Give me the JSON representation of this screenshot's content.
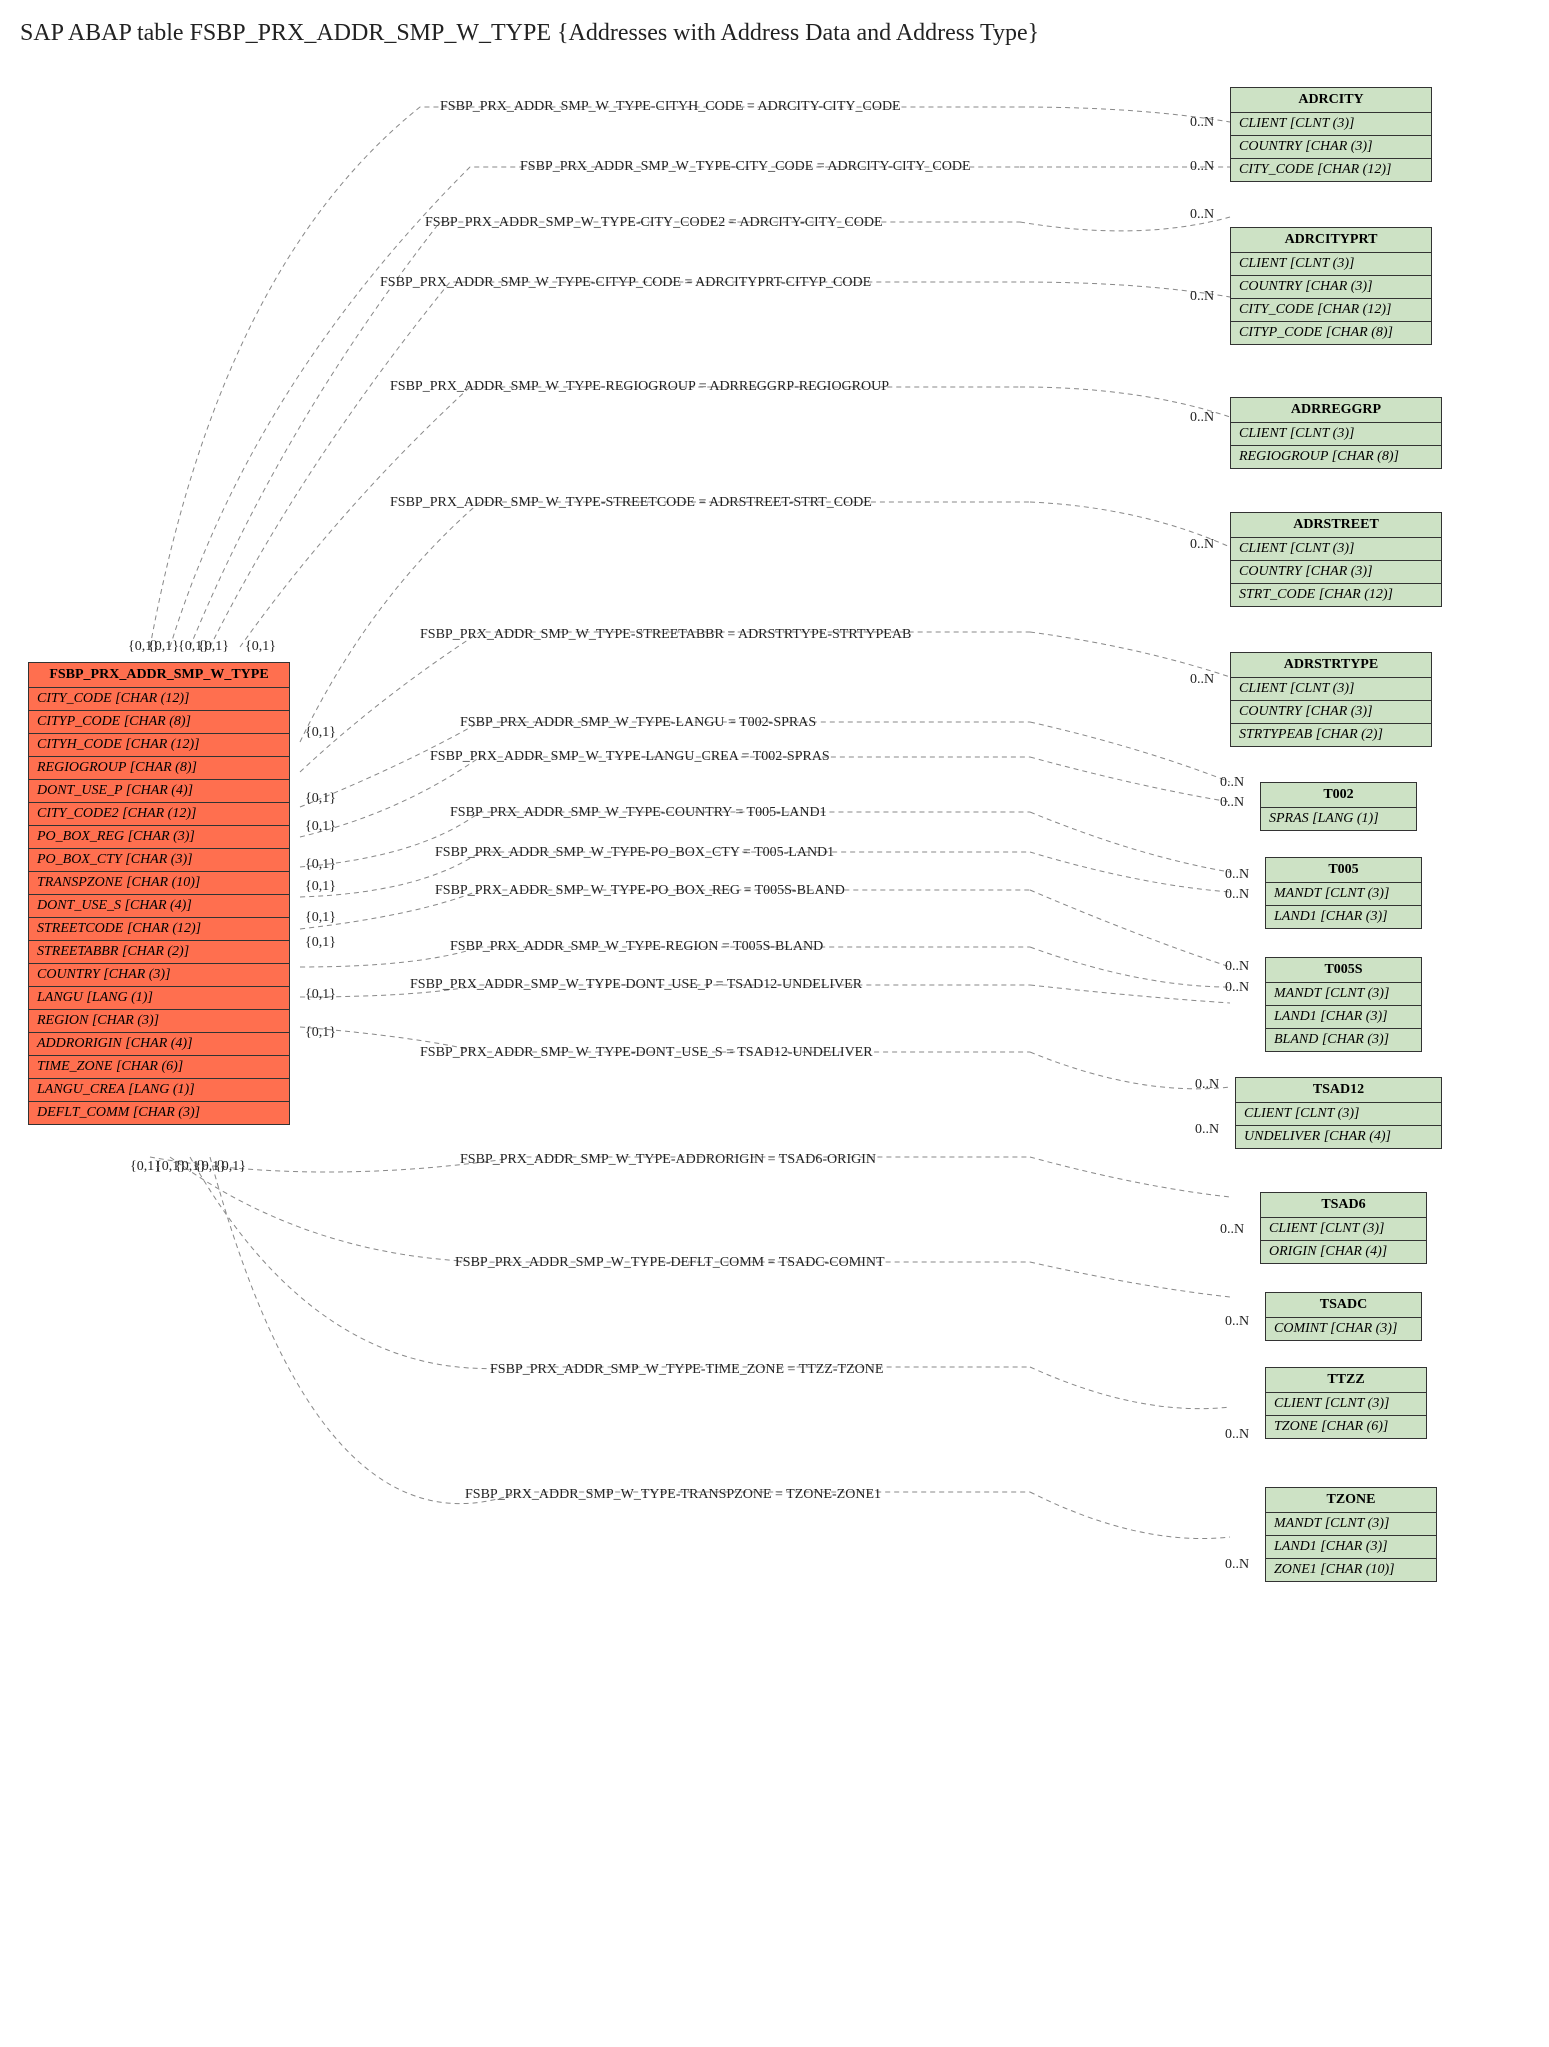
{
  "title": "SAP ABAP table FSBP_PRX_ADDR_SMP_W_TYPE {Addresses with Address Data and Address Type}",
  "main_entity": {
    "name": "FSBP_PRX_ADDR_SMP_W_TYPE",
    "fields": [
      "CITY_CODE [CHAR (12)]",
      "CITYP_CODE [CHAR (8)]",
      "CITYH_CODE [CHAR (12)]",
      "REGIOGROUP [CHAR (8)]",
      "DONT_USE_P [CHAR (4)]",
      "CITY_CODE2 [CHAR (12)]",
      "PO_BOX_REG [CHAR (3)]",
      "PO_BOX_CTY [CHAR (3)]",
      "TRANSPZONE [CHAR (10)]",
      "DONT_USE_S [CHAR (4)]",
      "STREETCODE [CHAR (12)]",
      "STREETABBR [CHAR (2)]",
      "COUNTRY [CHAR (3)]",
      "LANGU [LANG (1)]",
      "REGION [CHAR (3)]",
      "ADDRORIGIN [CHAR (4)]",
      "TIME_ZONE [CHAR (6)]",
      "LANGU_CREA [LANG (1)]",
      "DEFLT_COMM [CHAR (3)]"
    ]
  },
  "ref_entities": [
    {
      "name": "ADRCITY",
      "fields": [
        "CLIENT [CLNT (3)]",
        "COUNTRY [CHAR (3)]",
        "CITY_CODE [CHAR (12)]"
      ]
    },
    {
      "name": "ADRCITYPRT",
      "fields": [
        "CLIENT [CLNT (3)]",
        "COUNTRY [CHAR (3)]",
        "CITY_CODE [CHAR (12)]",
        "CITYP_CODE [CHAR (8)]"
      ]
    },
    {
      "name": "ADRREGGRP",
      "fields": [
        "CLIENT [CLNT (3)]",
        "REGIOGROUP [CHAR (8)]"
      ]
    },
    {
      "name": "ADRSTREET",
      "fields": [
        "CLIENT [CLNT (3)]",
        "COUNTRY [CHAR (3)]",
        "STRT_CODE [CHAR (12)]"
      ]
    },
    {
      "name": "ADRSTRTYPE",
      "fields": [
        "CLIENT [CLNT (3)]",
        "COUNTRY [CHAR (3)]",
        "STRTYPEAB [CHAR (2)]"
      ]
    },
    {
      "name": "T002",
      "fields": [
        "SPRAS [LANG (1)]"
      ]
    },
    {
      "name": "T005",
      "fields": [
        "MANDT [CLNT (3)]",
        "LAND1 [CHAR (3)]"
      ]
    },
    {
      "name": "T005S",
      "fields": [
        "MANDT [CLNT (3)]",
        "LAND1 [CHAR (3)]",
        "BLAND [CHAR (3)]"
      ]
    },
    {
      "name": "TSAD12",
      "fields": [
        "CLIENT [CLNT (3)]",
        "UNDELIVER [CHAR (4)]"
      ]
    },
    {
      "name": "TSAD6",
      "fields": [
        "CLIENT [CLNT (3)]",
        "ORIGIN [CHAR (4)]"
      ]
    },
    {
      "name": "TSADC",
      "fields": [
        "COMINT [CHAR (3)]"
      ]
    },
    {
      "name": "TTZZ",
      "fields": [
        "CLIENT [CLNT (3)]",
        "TZONE [CHAR (6)]"
      ]
    },
    {
      "name": "TZONE",
      "fields": [
        "MANDT [CLNT (3)]",
        "LAND1 [CHAR (3)]",
        "ZONE1 [CHAR (10)]"
      ]
    }
  ],
  "relations": [
    {
      "text": "FSBP_PRX_ADDR_SMP_W_TYPE-CITYH_CODE = ADRCITY-CITY_CODE"
    },
    {
      "text": "FSBP_PRX_ADDR_SMP_W_TYPE-CITY_CODE = ADRCITY-CITY_CODE"
    },
    {
      "text": "FSBP_PRX_ADDR_SMP_W_TYPE-CITY_CODE2 = ADRCITY-CITY_CODE"
    },
    {
      "text": "FSBP_PRX_ADDR_SMP_W_TYPE-CITYP_CODE = ADRCITYPRT-CITYP_CODE"
    },
    {
      "text": "FSBP_PRX_ADDR_SMP_W_TYPE-REGIOGROUP = ADRREGGRP-REGIOGROUP"
    },
    {
      "text": "FSBP_PRX_ADDR_SMP_W_TYPE-STREETCODE = ADRSTREET-STRT_CODE"
    },
    {
      "text": "FSBP_PRX_ADDR_SMP_W_TYPE-STREETABBR = ADRSTRTYPE-STRTYPEAB"
    },
    {
      "text": "FSBP_PRX_ADDR_SMP_W_TYPE-LANGU = T002-SPRAS"
    },
    {
      "text": "FSBP_PRX_ADDR_SMP_W_TYPE-LANGU_CREA = T002-SPRAS"
    },
    {
      "text": "FSBP_PRX_ADDR_SMP_W_TYPE-COUNTRY = T005-LAND1"
    },
    {
      "text": "FSBP_PRX_ADDR_SMP_W_TYPE-PO_BOX_CTY = T005-LAND1"
    },
    {
      "text": "FSBP_PRX_ADDR_SMP_W_TYPE-PO_BOX_REG = T005S-BLAND"
    },
    {
      "text": "FSBP_PRX_ADDR_SMP_W_TYPE-REGION = T005S-BLAND"
    },
    {
      "text": "FSBP_PRX_ADDR_SMP_W_TYPE-DONT_USE_P = TSAD12-UNDELIVER"
    },
    {
      "text": "FSBP_PRX_ADDR_SMP_W_TYPE-DONT_USE_S = TSAD12-UNDELIVER"
    },
    {
      "text": "FSBP_PRX_ADDR_SMP_W_TYPE-ADDRORIGIN = TSAD6-ORIGIN"
    },
    {
      "text": "FSBP_PRX_ADDR_SMP_W_TYPE-DEFLT_COMM = TSADC-COMINT"
    },
    {
      "text": "FSBP_PRX_ADDR_SMP_W_TYPE-TIME_ZONE = TTZZ-TZONE"
    },
    {
      "text": "FSBP_PRX_ADDR_SMP_W_TYPE-TRANSPZONE = TZONE-ZONE1"
    }
  ],
  "cardinalities": {
    "left_top": [
      "{0,1}",
      "{0,1}",
      "{0,1}",
      "{0,1}",
      "{0,1}"
    ],
    "left_bottom": [
      "{0,1}",
      "{0,1}",
      "{0,1}",
      "{0,1}",
      "{0,1}"
    ],
    "right_side": [
      "{0,1}",
      "{0,1}",
      "{0,1}",
      "{0,1}",
      "{0,1}",
      "{0,1}",
      "{0,1}",
      "{0,1}",
      "{0,1}"
    ],
    "right_n": [
      "0..N",
      "0..N",
      "0..N",
      "0..N",
      "0..N",
      "0..N",
      "0..N",
      "0..N",
      "0..N",
      "0..N",
      "0..N",
      "0..N",
      "0..N",
      "0..N",
      "0..N",
      "0..N",
      "0..N",
      "0..N",
      "0..N"
    ]
  }
}
